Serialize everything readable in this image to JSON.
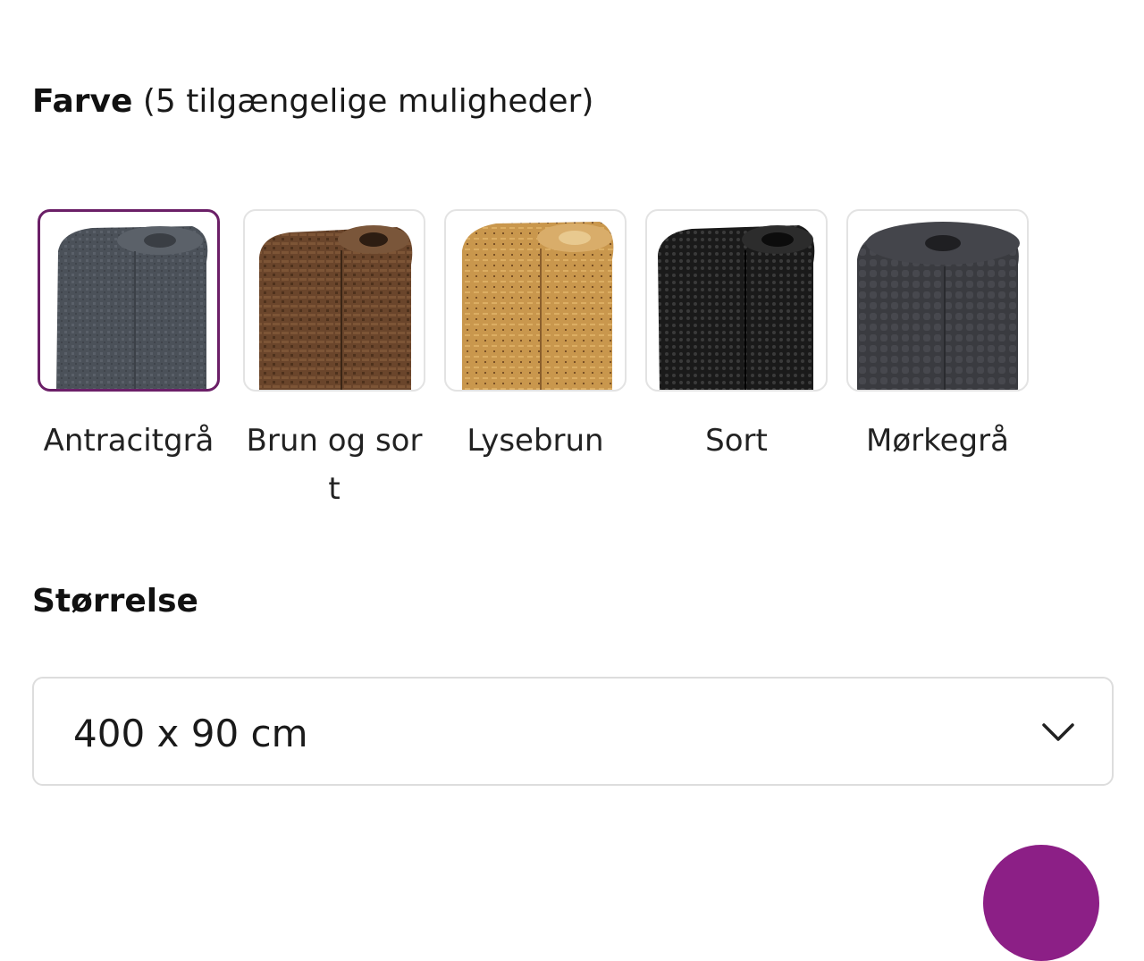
{
  "variants": {
    "color_label": "Farve",
    "color_count_text": "(5 tilgængelige muligheder)",
    "options": [
      {
        "name": "Antracitgrå",
        "selected": true,
        "color": "#4a5058"
      },
      {
        "name": "Brun og sort",
        "selected": false,
        "color": "#6f4a2e"
      },
      {
        "name": "Lysebrun",
        "selected": false,
        "color": "#c9994f"
      },
      {
        "name": "Sort",
        "selected": false,
        "color": "#1c1c1c"
      },
      {
        "name": "Mørkegrå",
        "selected": false,
        "color": "#3c3d42"
      }
    ],
    "selected_border_color": "#6b1f67"
  },
  "size": {
    "label": "Størrelse",
    "selected_value": "400 x 90 cm",
    "icon": "chevron-down-icon"
  },
  "accent_color": "#8c1f86"
}
